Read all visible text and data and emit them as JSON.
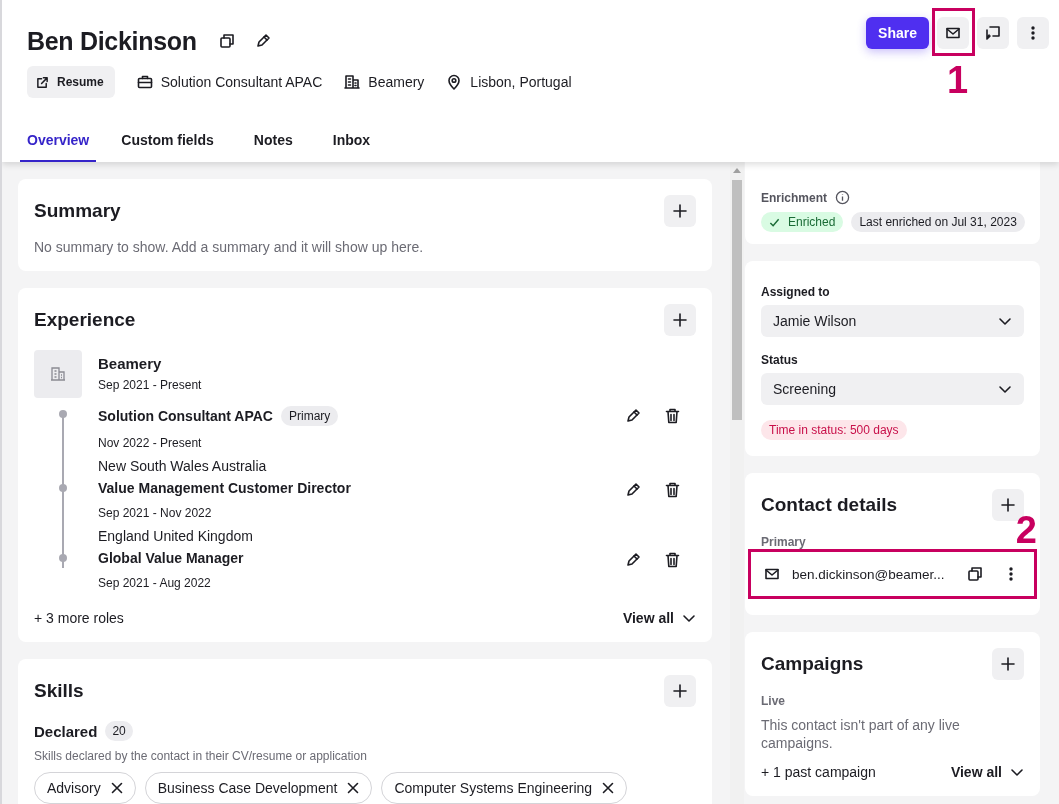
{
  "profile": {
    "name": "Ben Dickinson",
    "resume_button": "Resume",
    "details": [
      {
        "kind": "job",
        "text": "Solution Consultant APAC"
      },
      {
        "kind": "company",
        "text": "Beamery"
      },
      {
        "kind": "location",
        "text": "Lisbon, Portugal"
      }
    ]
  },
  "header_actions": {
    "share": "Share"
  },
  "annotations": [
    {
      "label": "1"
    },
    {
      "label": "2"
    }
  ],
  "tabs": [
    {
      "label": "Overview",
      "selected": true
    },
    {
      "label": "Custom fields",
      "selected": false
    },
    {
      "label": "Notes",
      "selected": false
    },
    {
      "label": "Inbox",
      "selected": false
    }
  ],
  "summary": {
    "title": "Summary",
    "empty_text": "No summary to show. Add a summary and it will show up here."
  },
  "experience": {
    "title": "Experience",
    "company": {
      "name": "Beamery",
      "dates": "Sep 2021 - Present"
    },
    "roles": [
      {
        "title": "Solution Consultant APAC",
        "badge": "Primary",
        "dates": "Nov 2022 - Present",
        "location": "New South Wales Australia"
      },
      {
        "title": "Value Management Customer Director",
        "dates": "Sep 2021 - Nov 2022",
        "location": "England United Kingdom"
      },
      {
        "title": "Global Value Manager",
        "dates": "Sep 2021 - Aug 2022"
      }
    ],
    "more": "+ 3 more roles",
    "view_all": "View all"
  },
  "skills": {
    "title": "Skills",
    "group": {
      "title": "Declared",
      "count": "20",
      "description": "Skills declared by the contact in their CV/resume or application",
      "tags": [
        "Advisory",
        "Business Case Development",
        "Computer Systems Engineering"
      ]
    }
  },
  "enrichment": {
    "label": "Enrichment",
    "status": "Enriched",
    "last": "Last enriched on Jul 31, 2023"
  },
  "assignment": {
    "fields": [
      {
        "label": "Assigned to",
        "value": "Jamie Wilson"
      },
      {
        "label": "Status",
        "value": "Screening"
      }
    ],
    "time_in_status": "Time in status: 500 days"
  },
  "contact": {
    "title": "Contact details",
    "section": "Primary",
    "email": "ben.dickinson@beamer..."
  },
  "campaigns": {
    "title": "Campaigns",
    "section": "Live",
    "empty_text": "This contact isn't part of any live campaigns.",
    "more": "+ 1 past campaign",
    "view_all": "View all"
  }
}
